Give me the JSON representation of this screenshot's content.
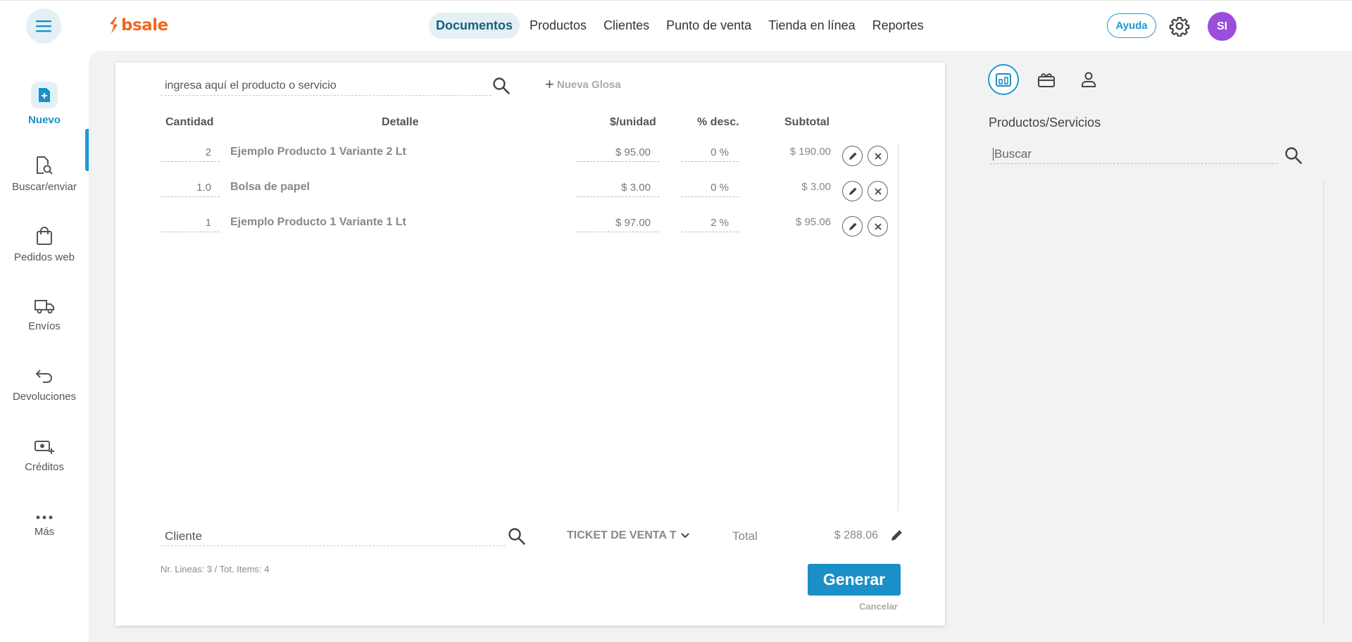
{
  "app": {
    "logo_text": "bsale",
    "brand_color": "#f26722",
    "accent_color": "#1b9ad6"
  },
  "topnav": {
    "items": [
      {
        "label": "Documentos",
        "active": true
      },
      {
        "label": "Productos"
      },
      {
        "label": "Clientes"
      },
      {
        "label": "Punto de venta"
      },
      {
        "label": "Tienda en línea"
      },
      {
        "label": "Reportes"
      }
    ],
    "help_label": "Ayuda",
    "avatar_initials": "SI"
  },
  "sidebar": {
    "items": [
      {
        "label": "Nuevo",
        "icon": "new-document-icon",
        "active": true
      },
      {
        "label": "Buscar/enviar",
        "icon": "search-document-icon"
      },
      {
        "label": "Pedidos web",
        "icon": "shopping-bag-icon"
      },
      {
        "label": "Envíos",
        "icon": "truck-icon"
      },
      {
        "label": "Devoluciones",
        "icon": "return-arrow-icon"
      },
      {
        "label": "Créditos",
        "icon": "money-plus-icon"
      },
      {
        "label": "Más",
        "icon": "more-dots-icon"
      }
    ]
  },
  "document": {
    "product_search_text": "ingresa aquí el producto o servicio",
    "nueva_glosa_label": "Nueva Glosa",
    "columns": {
      "qty": "Cantidad",
      "detail": "Detalle",
      "price": "$/unidad",
      "discount": "% desc.",
      "subtotal": "Subtotal"
    },
    "rows": [
      {
        "qty": "2",
        "detail": "Ejemplo Producto 1 Variante 2 Lt",
        "price": "$ 95.00",
        "discount": "0 %",
        "subtotal": "$ 190.00"
      },
      {
        "qty": "1.0",
        "detail": "Bolsa de papel",
        "price": "$ 3.00",
        "discount": "0 %",
        "subtotal": "$ 3.00"
      },
      {
        "qty": "1",
        "detail": "Ejemplo Producto 1 Variante 1 Lt",
        "price": "$ 97.00",
        "discount": "2 %",
        "subtotal": "$ 95.06"
      }
    ],
    "client_placeholder": "Cliente",
    "doc_type": "TICKET DE VENTA T",
    "total_label": "Total",
    "total_value": "$ 288.06",
    "summary": "Nr. Lineas: 3 / Tot. Items: 4",
    "generar_label": "Generar",
    "cancelar_label": "Cancelar"
  },
  "right_panel": {
    "tabs": [
      {
        "icon": "products-tab-icon",
        "active": true
      },
      {
        "icon": "gift-card-icon"
      },
      {
        "icon": "person-icon"
      }
    ],
    "title": "Productos/Servicios",
    "search_placeholder": "Buscar"
  }
}
